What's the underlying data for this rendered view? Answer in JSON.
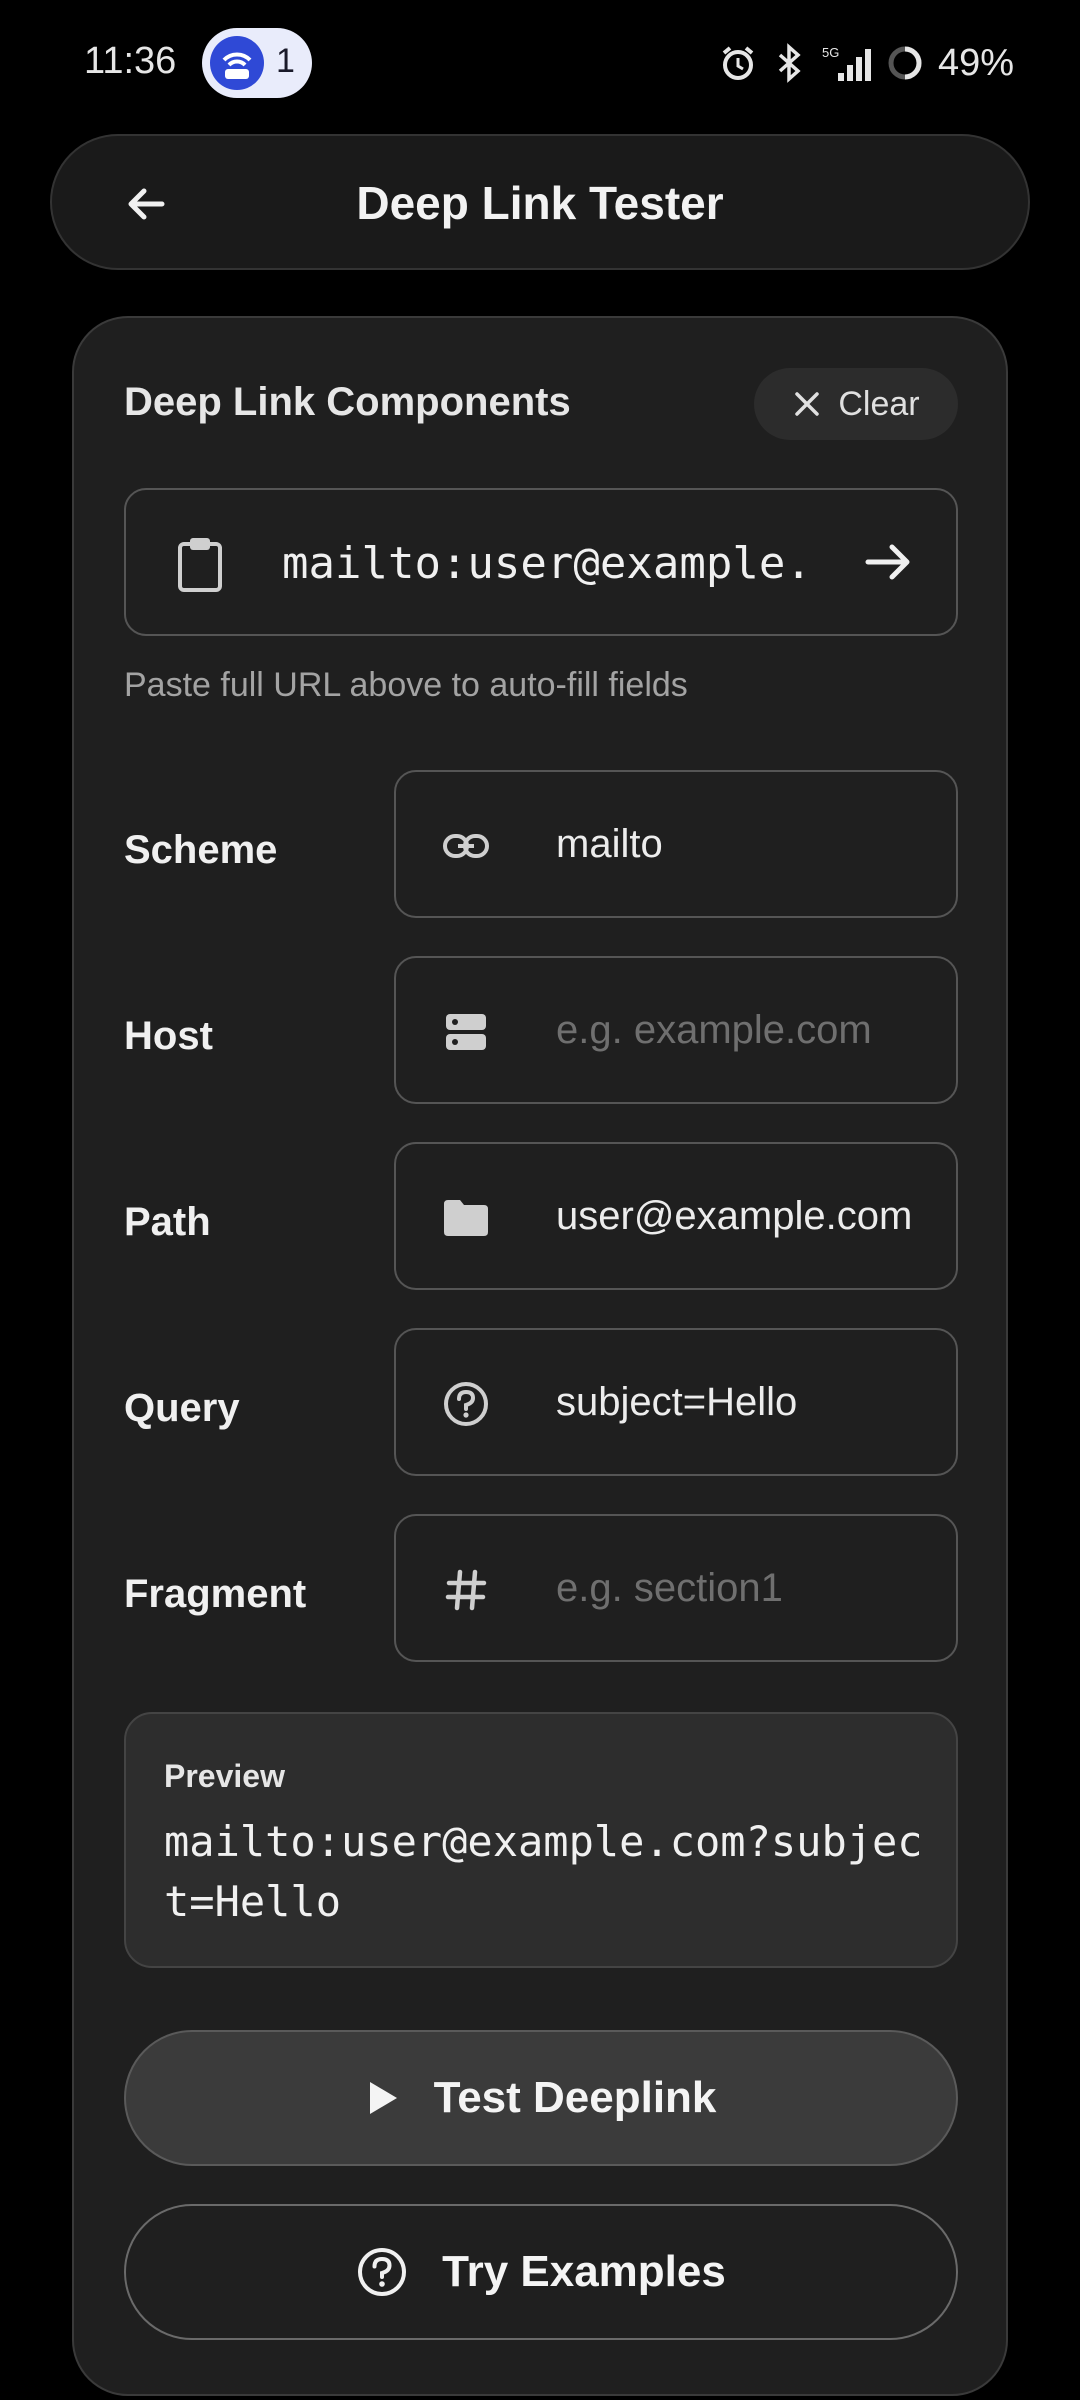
{
  "status_bar": {
    "time": "11:36",
    "notification_count": "1",
    "battery": "49%"
  },
  "app_bar": {
    "title": "Deep Link Tester"
  },
  "card": {
    "title": "Deep Link Components",
    "clear_label": "Clear",
    "url_value": "mailto:user@example.com?subject=Hello",
    "hint": "Paste full URL above to auto-fill fields"
  },
  "fields": [
    {
      "label": "Scheme",
      "icon": "link-icon",
      "value": "mailto",
      "placeholder": ""
    },
    {
      "label": "Host",
      "icon": "dns-icon",
      "value": "",
      "placeholder": "e.g. example.com"
    },
    {
      "label": "Path",
      "icon": "folder-icon",
      "value": "user@example.com",
      "placeholder": ""
    },
    {
      "label": "Query",
      "icon": "help-circle-icon",
      "value": "subject=Hello",
      "placeholder": ""
    },
    {
      "label": "Fragment",
      "icon": "hash-icon",
      "value": "",
      "placeholder": "e.g. section1"
    }
  ],
  "preview": {
    "label": "Preview",
    "value": "mailto:user@example.com?subject=Hello"
  },
  "buttons": {
    "test_label": "Test Deeplink",
    "examples_label": "Try Examples"
  }
}
